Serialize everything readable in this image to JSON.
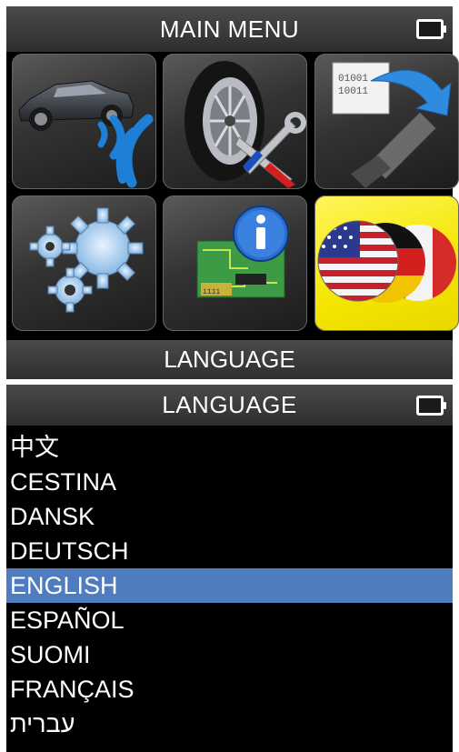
{
  "main_menu": {
    "title": "MAIN MENU",
    "selected_label": "LANGUAGE",
    "tiles": [
      {
        "icon": "car-sensor-signal-icon"
      },
      {
        "icon": "tire-tools-icon"
      },
      {
        "icon": "software-update-icon"
      },
      {
        "icon": "settings-gears-icon"
      },
      {
        "icon": "info-circuit-board-icon"
      },
      {
        "icon": "language-flags-icon",
        "selected": true
      }
    ]
  },
  "language_screen": {
    "title": "LANGUAGE",
    "items": [
      {
        "label": "中文"
      },
      {
        "label": "CESTINA"
      },
      {
        "label": "DANSK"
      },
      {
        "label": "DEUTSCH"
      },
      {
        "label": "ENGLISH",
        "selected": true
      },
      {
        "label": "ESPAÑOL"
      },
      {
        "label": "SUOMI"
      },
      {
        "label": "FRANÇAIS"
      },
      {
        "label": "עברית"
      }
    ]
  },
  "colors": {
    "selected_tile": "#f4e600",
    "selected_row": "#4f7bbf",
    "screen_bg": "#000000",
    "bar_bg": "#3a3a3a"
  }
}
